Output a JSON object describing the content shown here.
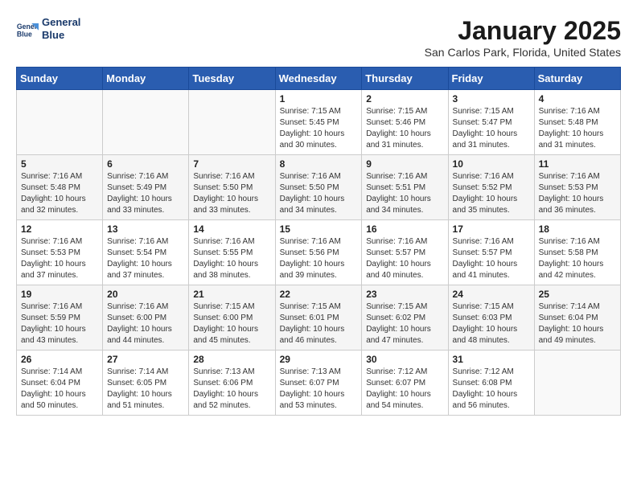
{
  "logo": {
    "line1": "General",
    "line2": "Blue"
  },
  "title": "January 2025",
  "location": "San Carlos Park, Florida, United States",
  "weekdays": [
    "Sunday",
    "Monday",
    "Tuesday",
    "Wednesday",
    "Thursday",
    "Friday",
    "Saturday"
  ],
  "weeks": [
    [
      {
        "day": "",
        "info": ""
      },
      {
        "day": "",
        "info": ""
      },
      {
        "day": "",
        "info": ""
      },
      {
        "day": "1",
        "info": "Sunrise: 7:15 AM\nSunset: 5:45 PM\nDaylight: 10 hours\nand 30 minutes."
      },
      {
        "day": "2",
        "info": "Sunrise: 7:15 AM\nSunset: 5:46 PM\nDaylight: 10 hours\nand 31 minutes."
      },
      {
        "day": "3",
        "info": "Sunrise: 7:15 AM\nSunset: 5:47 PM\nDaylight: 10 hours\nand 31 minutes."
      },
      {
        "day": "4",
        "info": "Sunrise: 7:16 AM\nSunset: 5:48 PM\nDaylight: 10 hours\nand 31 minutes."
      }
    ],
    [
      {
        "day": "5",
        "info": "Sunrise: 7:16 AM\nSunset: 5:48 PM\nDaylight: 10 hours\nand 32 minutes."
      },
      {
        "day": "6",
        "info": "Sunrise: 7:16 AM\nSunset: 5:49 PM\nDaylight: 10 hours\nand 33 minutes."
      },
      {
        "day": "7",
        "info": "Sunrise: 7:16 AM\nSunset: 5:50 PM\nDaylight: 10 hours\nand 33 minutes."
      },
      {
        "day": "8",
        "info": "Sunrise: 7:16 AM\nSunset: 5:50 PM\nDaylight: 10 hours\nand 34 minutes."
      },
      {
        "day": "9",
        "info": "Sunrise: 7:16 AM\nSunset: 5:51 PM\nDaylight: 10 hours\nand 34 minutes."
      },
      {
        "day": "10",
        "info": "Sunrise: 7:16 AM\nSunset: 5:52 PM\nDaylight: 10 hours\nand 35 minutes."
      },
      {
        "day": "11",
        "info": "Sunrise: 7:16 AM\nSunset: 5:53 PM\nDaylight: 10 hours\nand 36 minutes."
      }
    ],
    [
      {
        "day": "12",
        "info": "Sunrise: 7:16 AM\nSunset: 5:53 PM\nDaylight: 10 hours\nand 37 minutes."
      },
      {
        "day": "13",
        "info": "Sunrise: 7:16 AM\nSunset: 5:54 PM\nDaylight: 10 hours\nand 37 minutes."
      },
      {
        "day": "14",
        "info": "Sunrise: 7:16 AM\nSunset: 5:55 PM\nDaylight: 10 hours\nand 38 minutes."
      },
      {
        "day": "15",
        "info": "Sunrise: 7:16 AM\nSunset: 5:56 PM\nDaylight: 10 hours\nand 39 minutes."
      },
      {
        "day": "16",
        "info": "Sunrise: 7:16 AM\nSunset: 5:57 PM\nDaylight: 10 hours\nand 40 minutes."
      },
      {
        "day": "17",
        "info": "Sunrise: 7:16 AM\nSunset: 5:57 PM\nDaylight: 10 hours\nand 41 minutes."
      },
      {
        "day": "18",
        "info": "Sunrise: 7:16 AM\nSunset: 5:58 PM\nDaylight: 10 hours\nand 42 minutes."
      }
    ],
    [
      {
        "day": "19",
        "info": "Sunrise: 7:16 AM\nSunset: 5:59 PM\nDaylight: 10 hours\nand 43 minutes."
      },
      {
        "day": "20",
        "info": "Sunrise: 7:16 AM\nSunset: 6:00 PM\nDaylight: 10 hours\nand 44 minutes."
      },
      {
        "day": "21",
        "info": "Sunrise: 7:15 AM\nSunset: 6:00 PM\nDaylight: 10 hours\nand 45 minutes."
      },
      {
        "day": "22",
        "info": "Sunrise: 7:15 AM\nSunset: 6:01 PM\nDaylight: 10 hours\nand 46 minutes."
      },
      {
        "day": "23",
        "info": "Sunrise: 7:15 AM\nSunset: 6:02 PM\nDaylight: 10 hours\nand 47 minutes."
      },
      {
        "day": "24",
        "info": "Sunrise: 7:15 AM\nSunset: 6:03 PM\nDaylight: 10 hours\nand 48 minutes."
      },
      {
        "day": "25",
        "info": "Sunrise: 7:14 AM\nSunset: 6:04 PM\nDaylight: 10 hours\nand 49 minutes."
      }
    ],
    [
      {
        "day": "26",
        "info": "Sunrise: 7:14 AM\nSunset: 6:04 PM\nDaylight: 10 hours\nand 50 minutes."
      },
      {
        "day": "27",
        "info": "Sunrise: 7:14 AM\nSunset: 6:05 PM\nDaylight: 10 hours\nand 51 minutes."
      },
      {
        "day": "28",
        "info": "Sunrise: 7:13 AM\nSunset: 6:06 PM\nDaylight: 10 hours\nand 52 minutes."
      },
      {
        "day": "29",
        "info": "Sunrise: 7:13 AM\nSunset: 6:07 PM\nDaylight: 10 hours\nand 53 minutes."
      },
      {
        "day": "30",
        "info": "Sunrise: 7:12 AM\nSunset: 6:07 PM\nDaylight: 10 hours\nand 54 minutes."
      },
      {
        "day": "31",
        "info": "Sunrise: 7:12 AM\nSunset: 6:08 PM\nDaylight: 10 hours\nand 56 minutes."
      },
      {
        "day": "",
        "info": ""
      }
    ]
  ]
}
